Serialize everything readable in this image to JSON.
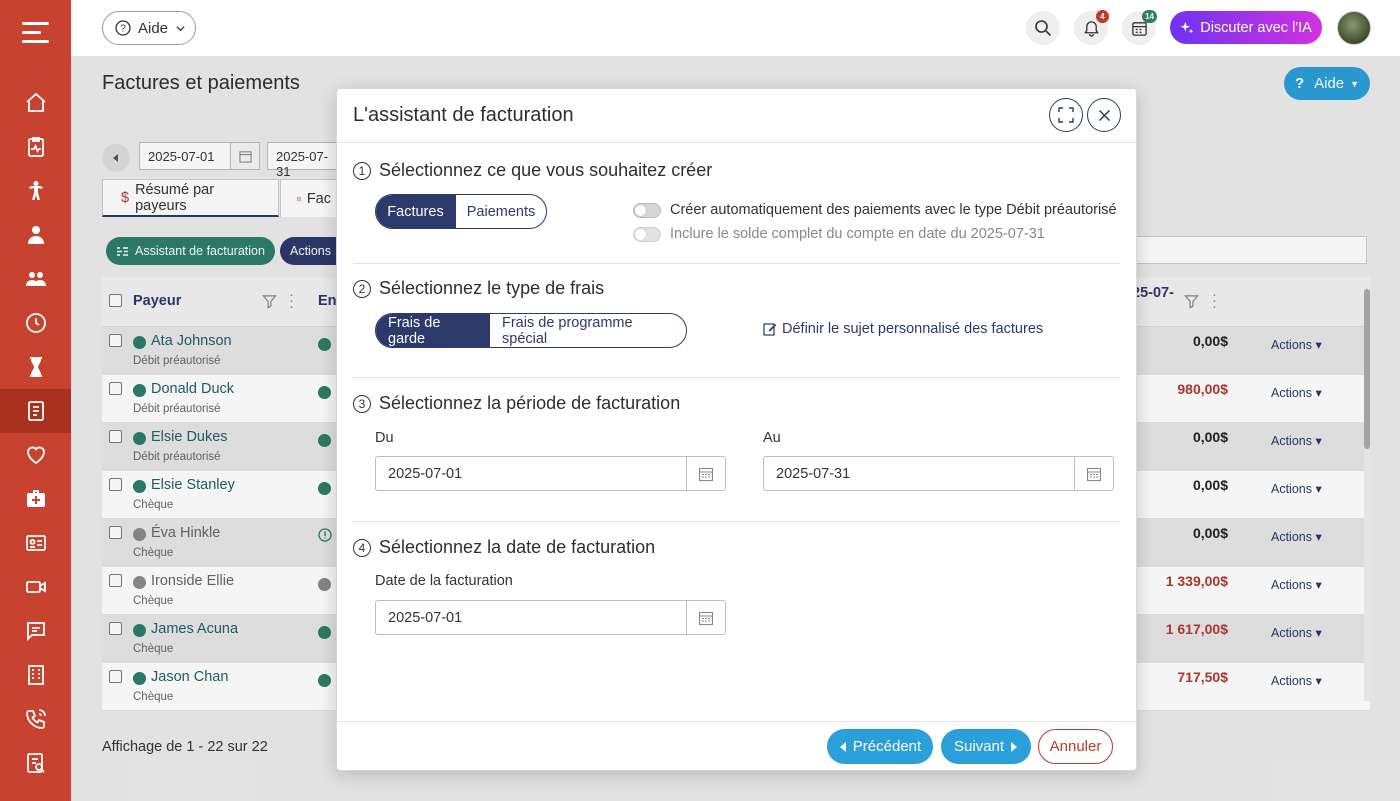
{
  "topbar": {
    "help_label": "Aide",
    "notifications_count": "4",
    "calendar_count": "14",
    "ai_button_label": "Discuter avec l'IA"
  },
  "page": {
    "title": "Factures et paiements",
    "aide_button": "Aide",
    "start_date": "2025-07-01",
    "end_date": "2025-07-31",
    "tabs": [
      {
        "label": "Résumé par payeurs",
        "icon": "dollar-icon"
      },
      {
        "label": "Fac",
        "icon": "invoice-icon"
      }
    ],
    "billing_assistant_button": "Assistant de facturation",
    "actions_button": "Actions",
    "footer_count": "Affichage de 1 - 22 sur 22"
  },
  "table": {
    "headers": {
      "payer": "Payeur",
      "col2": "Ent",
      "date_col": "25-07-"
    },
    "rows": [
      {
        "name": "Ata Johnson",
        "sub": "Débit préautorisé",
        "status": "active",
        "amount": "0,00$",
        "amount_color": "#222",
        "action": "Actions"
      },
      {
        "name": "Donald Duck",
        "sub": "Débit préautorisé",
        "status": "active",
        "amount": "980,00$",
        "amount_color": "#b03a2e",
        "action": "Actions"
      },
      {
        "name": "Elsie Dukes",
        "sub": "Débit préautorisé",
        "status": "active",
        "amount": "0,00$",
        "amount_color": "#222",
        "action": "Actions"
      },
      {
        "name": "Elsie Stanley",
        "sub": "Chèque",
        "status": "active",
        "amount": "0,00$",
        "amount_color": "#222",
        "action": "Actions"
      },
      {
        "name": "Éva Hinkle",
        "sub": "Chèque",
        "status": "inactive",
        "amount": "0,00$",
        "amount_color": "#222",
        "action": "Actions"
      },
      {
        "name": "Ironside Ellie",
        "sub": "Chèque",
        "status": "inactive",
        "amount": "1 339,00$",
        "amount_color": "#b03a2e",
        "action": "Actions"
      },
      {
        "name": "James Acuna",
        "sub": "Chèque",
        "status": "active",
        "amount": "1 617,00$",
        "amount_color": "#b03a2e",
        "action": "Actions"
      },
      {
        "name": "Jason Chan",
        "sub": "Chèque",
        "status": "active",
        "amount": "717,50$",
        "amount_color": "#b03a2e",
        "action": "Actions"
      }
    ]
  },
  "modal": {
    "title": "L'assistant de facturation",
    "step1": {
      "num": "1",
      "title": "Sélectionnez ce que vous souhaitez créer",
      "options": [
        "Factures",
        "Paiements"
      ],
      "selected": "Factures",
      "toggle1_label": "Créer automatiquement des paiements avec le type Débit préautorisé",
      "toggle1_on": false,
      "toggle2_label": "Inclure le solde complet du compte en date du 2025-07-31",
      "toggle2_on": false
    },
    "step2": {
      "num": "2",
      "title": "Sélectionnez le type de frais",
      "options": [
        "Frais de garde",
        "Frais de programme spécial"
      ],
      "selected": "Frais de garde",
      "link_label": "Définir le sujet personnalisé des factures"
    },
    "step3": {
      "num": "3",
      "title": "Sélectionnez la période de facturation",
      "from_label": "Du",
      "from_value": "2025-07-01",
      "to_label": "Au",
      "to_value": "2025-07-31"
    },
    "step4": {
      "num": "4",
      "title": "Sélectionnez la date de facturation",
      "label": "Date de la facturation",
      "value": "2025-07-01"
    },
    "footer": {
      "prev_label": "Précédent",
      "next_label": "Suivant",
      "cancel_label": "Annuler"
    }
  },
  "colors": {
    "sidebar": "#c8432f",
    "primary": "#2b3a6b",
    "accent_blue": "#2b9fd9",
    "teal": "#2e7d6b",
    "cancel": "#c0392b"
  }
}
